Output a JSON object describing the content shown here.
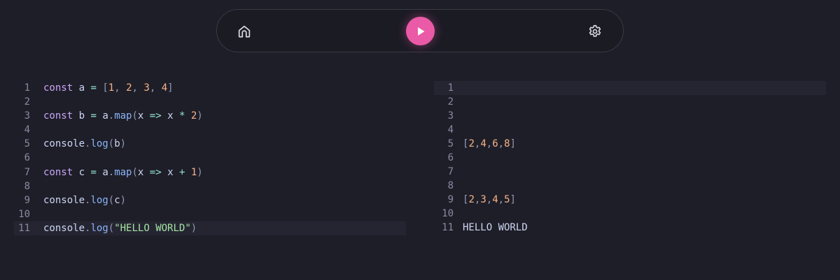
{
  "toolbar": {
    "home_icon": "home-icon",
    "run_icon": "play-icon",
    "settings_icon": "gear-icon",
    "accent": "#ea5aa6"
  },
  "editor": {
    "line_numbers": [
      "1",
      "2",
      "3",
      "4",
      "5",
      "6",
      "7",
      "8",
      "9",
      "10",
      "11"
    ],
    "lines": [
      "const a = [1, 2, 3, 4]",
      "",
      "const b = a.map(x => x * 2)",
      "",
      "console.log(b)",
      "",
      "const c = a.map(x => x + 1)",
      "",
      "console.log(c)",
      "",
      "console.log(\"HELLO WORLD\")"
    ],
    "active_line": 11
  },
  "output": {
    "line_numbers": [
      "1",
      "2",
      "3",
      "4",
      "5",
      "6",
      "7",
      "8",
      "9",
      "10",
      "11"
    ],
    "lines": [
      "",
      "",
      "",
      "",
      "[2,4,6,8]",
      "",
      "",
      "",
      "[2,3,4,5]",
      "",
      "HELLO WORLD"
    ],
    "active_line": 1
  }
}
